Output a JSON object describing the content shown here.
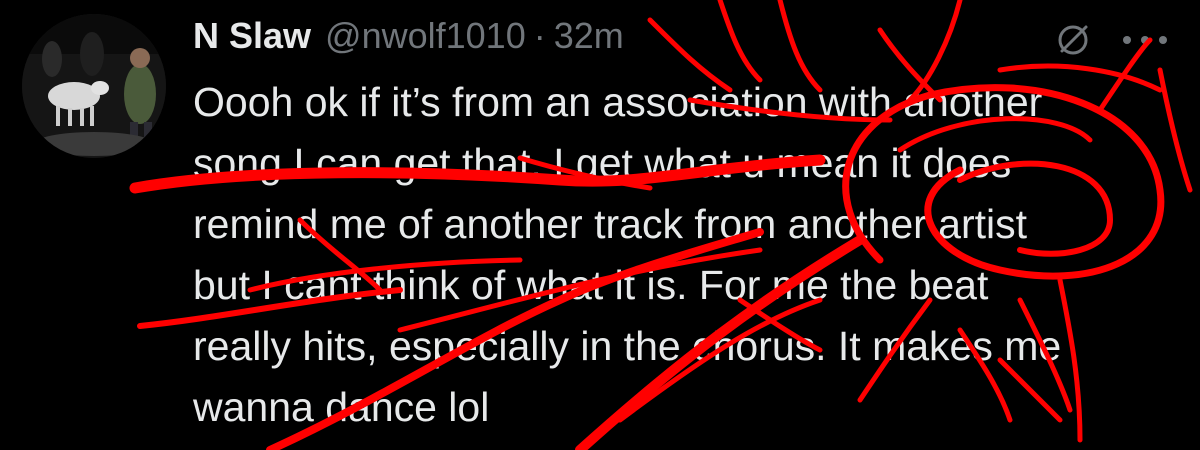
{
  "tweet": {
    "display_name": "N Slaw",
    "handle": "@nwolf1010",
    "separator": "·",
    "timestamp": "32m",
    "text": "Oooh ok if it’s from an association with another song I can get that. I get what u mean it does remind me of another track from another artist but I cant think of what it is. For me the beat really hits, especially in the chorus. It makes me wanna dance lol"
  },
  "icons": {
    "grok": "grok-icon",
    "more": "more-options-icon"
  },
  "colors": {
    "background": "#000000",
    "text_primary": "#e7e9ea",
    "text_secondary": "#71767b",
    "scribble": "#ff0000"
  }
}
